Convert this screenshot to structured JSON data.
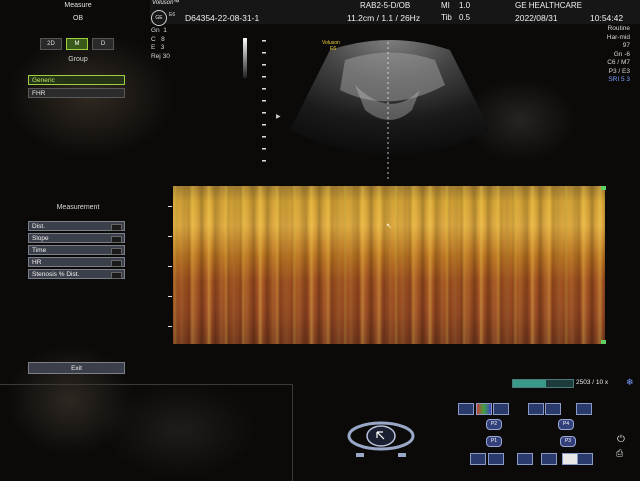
{
  "left_panel": {
    "title": "Measure",
    "subtitle": "OB",
    "mode_tabs": [
      {
        "label": "2D",
        "active": false
      },
      {
        "label": "M",
        "active": true
      },
      {
        "label": "D",
        "active": false
      }
    ],
    "group_title": "Group",
    "group_items": [
      {
        "label": "Generic",
        "active": true
      },
      {
        "label": "FHR",
        "active": false
      }
    ],
    "measurement_title": "Measurement",
    "measurement_items": [
      {
        "label": "Dist."
      },
      {
        "label": "Slope"
      },
      {
        "label": "Time"
      },
      {
        "label": "HR"
      },
      {
        "label": "Stenosis % Dist."
      }
    ],
    "exit_label": "Exit"
  },
  "header": {
    "brand_top": "Voluson™",
    "brand_sub": "E6",
    "ge_logo": "GE",
    "patient_id": "D64354-22-08-31-1",
    "probe": "RAB2-5-D/OB",
    "depth_info": "11.2cm / 1.1 / 26Hz",
    "mi_label": "MI",
    "mi_value": "1.0",
    "tib_label": "Tib",
    "tib_value": "0.5",
    "institution": "GE HEALTHCARE",
    "date": "2022/08/31",
    "time": "10:54:42"
  },
  "left_params": [
    {
      "label": "Gn",
      "value": "1"
    },
    {
      "label": "C",
      "value": "8"
    },
    {
      "label": "E",
      "value": "3"
    },
    {
      "label": "Rej",
      "value": "30"
    }
  ],
  "right_params": [
    "Routine",
    "Har-mid",
    "97",
    "Gn -6",
    "C6 / M7",
    "P3 / E3",
    "SRI 5 3"
  ],
  "image_logo": {
    "line1": "Voluson",
    "line2": "E6"
  },
  "sweep": {
    "label": "2503 / 10 x",
    "fill_fraction": 0.55
  },
  "colors": {
    "accent_green": "#9fd040",
    "m_mode_warm": "#c68a22",
    "button_blue": "#3a3f4a"
  },
  "bottom_controls": {
    "p_buttons": [
      "P2",
      "P1",
      "P4",
      "P3"
    ]
  }
}
